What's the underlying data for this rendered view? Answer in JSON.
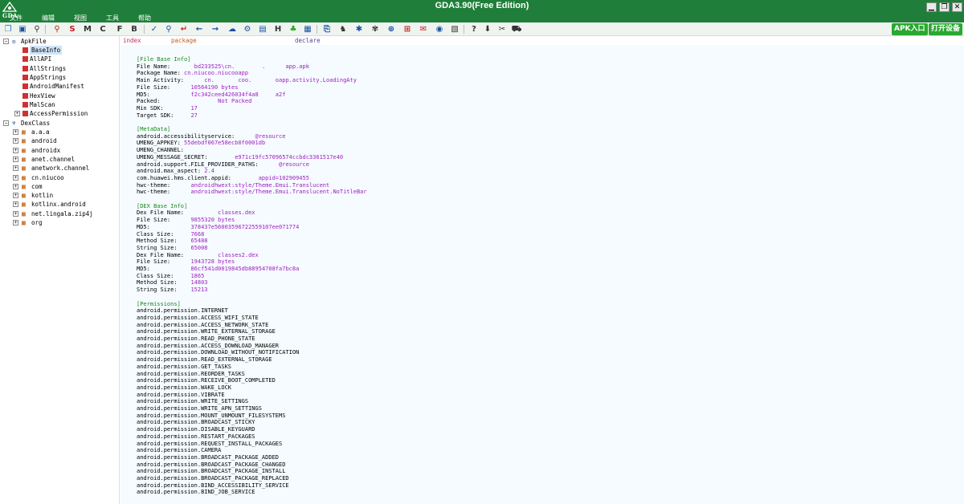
{
  "window": {
    "title": "GDA3.90(Free Edition)",
    "logo_text": "GDA",
    "menu": [
      "文件",
      "编辑",
      "视图",
      "工具",
      "帮助"
    ],
    "controls": [
      "minimize",
      "restore",
      "close"
    ]
  },
  "toolbar": {
    "letter_buttons": [
      "S",
      "M",
      "C",
      "F",
      "B"
    ],
    "apk_entry_label": "APK入口",
    "open_device_label": "打开设备"
  },
  "tree": {
    "apk_root": "ApkFile",
    "apk_children": [
      "BaseInfo",
      "AllAPI",
      "AllStrings",
      "AppStrings",
      "AndroidManifest",
      "HexView",
      "MalScan",
      "AccessPermission"
    ],
    "dex_root": "DexClass",
    "dex_children": [
      "a.a.a",
      "android",
      "androidx",
      "anet.channel",
      "anetwork.channel",
      "cn.niucoo",
      "com",
      "kotlin",
      "kotlinx.android",
      "net.lingala.zip4j",
      "org"
    ]
  },
  "columns": [
    "index",
    "package",
    "declare"
  ],
  "lines": [
    {
      "t": "sec",
      "text": "[File Base Info]"
    },
    {
      "t": "kv",
      "k": "File Name:       ",
      "v": "bd233525\\cn.        .      app.apk"
    },
    {
      "t": "kv",
      "k": "Package Name: ",
      "v": "cn.niucoo.niucooapp"
    },
    {
      "t": "kv",
      "k": "Main Activity:      ",
      "v": "cn.       coo.       oapp.activity.LoadingAty"
    },
    {
      "t": "kv",
      "k": "File Size:      ",
      "v": "10564190 bytes"
    },
    {
      "t": "kv",
      "k": "MD5:            ",
      "v": "f2c342ceed426034f4a8     a2f"
    },
    {
      "t": "kv",
      "k": "Packed:                 ",
      "v": "Not Packed"
    },
    {
      "t": "kv",
      "k": "Min SDK:        ",
      "v": "17"
    },
    {
      "t": "kv",
      "k": "Target SDK:     ",
      "v": "27"
    },
    {
      "t": "gap"
    },
    {
      "t": "sec",
      "text": "[MetaData]"
    },
    {
      "t": "kv",
      "k": "android.accessibilityservice:      ",
      "v": "@resource"
    },
    {
      "t": "kv",
      "k": "UMENG_APPKEY: ",
      "v": "55debdf067e58ecb0f0001db"
    },
    {
      "t": "kv",
      "k": "UMENG_CHANNEL:  ",
      "v": "     "
    },
    {
      "t": "kv",
      "k": "UMENG_MESSAGE_SECRET:        ",
      "v": "e971c19fc57096574ccbdc3361517e40"
    },
    {
      "t": "kv",
      "k": "android.support.FILE_PROVIDER_PATHS:      ",
      "v": "@resource"
    },
    {
      "t": "kv",
      "k": "android.max_aspect: ",
      "v": "2.4"
    },
    {
      "t": "kv",
      "k": "com.huawei.hms.client.appid:        ",
      "v": "appid=102909455"
    },
    {
      "t": "kv",
      "k": "hwc-theme:      ",
      "v": "androidhwext:style/Theme.Emui.Translucent"
    },
    {
      "t": "kv",
      "k": "hwc-theme:      ",
      "v": "androidhwext:style/Theme.Emui.Translucent.NoTitleBar"
    },
    {
      "t": "gap"
    },
    {
      "t": "sec",
      "text": "[DEX Base Info]"
    },
    {
      "t": "kv",
      "k": "Dex File Name:          ",
      "v": "classes.dex"
    },
    {
      "t": "kv",
      "k": "File Size:      ",
      "v": "9855320 bytes"
    },
    {
      "t": "kv",
      "k": "MD5:            ",
      "v": "378437e56003596722559107ee071774"
    },
    {
      "t": "kv",
      "k": "Class Size:     ",
      "v": "7668"
    },
    {
      "t": "kv",
      "k": "Method Size:    ",
      "v": "65488"
    },
    {
      "t": "kv",
      "k": "String Size:    ",
      "v": "65008"
    },
    {
      "t": "kv",
      "k": "Dex File Name:          ",
      "v": "classes2.dex"
    },
    {
      "t": "kv",
      "k": "File Size:      ",
      "v": "1943728 bytes"
    },
    {
      "t": "kv",
      "k": "MD5:            ",
      "v": "86cf541d0019845db88954708fa7bc8a"
    },
    {
      "t": "kv",
      "k": "Class Size:     ",
      "v": "1865"
    },
    {
      "t": "kv",
      "k": "Method Size:    ",
      "v": "14803"
    },
    {
      "t": "kv",
      "k": "String Size:    ",
      "v": "15213"
    },
    {
      "t": "gap"
    },
    {
      "t": "sec",
      "text": "[Permissions]"
    },
    {
      "t": "p",
      "text": "android.permission.INTERNET"
    },
    {
      "t": "p",
      "text": "android.permission.ACCESS_WIFI_STATE"
    },
    {
      "t": "p",
      "text": "android.permission.ACCESS_NETWORK_STATE"
    },
    {
      "t": "p",
      "text": "android.permission.WRITE_EXTERNAL_STORAGE"
    },
    {
      "t": "p",
      "text": "android.permission.READ_PHONE_STATE"
    },
    {
      "t": "p",
      "text": "android.permission.ACCESS_DOWNLOAD_MANAGER"
    },
    {
      "t": "p",
      "text": "android.permission.DOWNLOAD_WITHOUT_NOTIFICATION"
    },
    {
      "t": "p",
      "text": "android.permission.READ_EXTERNAL_STORAGE"
    },
    {
      "t": "p",
      "text": "android.permission.GET_TASKS"
    },
    {
      "t": "p",
      "text": "android.permission.REORDER_TASKS"
    },
    {
      "t": "p",
      "text": "android.permission.RECEIVE_BOOT_COMPLETED"
    },
    {
      "t": "p",
      "text": "android.permission.WAKE_LOCK"
    },
    {
      "t": "p",
      "text": "android.permission.VIBRATE"
    },
    {
      "t": "p",
      "text": "android.permission.WRITE_SETTINGS"
    },
    {
      "t": "p",
      "text": "android.permission.WRITE_APN_SETTINGS"
    },
    {
      "t": "p",
      "text": "android.permission.MOUNT_UNMOUNT_FILESYSTEMS"
    },
    {
      "t": "p",
      "text": "android.permission.BROADCAST_STICKY"
    },
    {
      "t": "p",
      "text": "android.permission.DISABLE_KEYGUARD"
    },
    {
      "t": "p",
      "text": "android.permission.RESTART_PACKAGES"
    },
    {
      "t": "p",
      "text": "android.permission.REQUEST_INSTALL_PACKAGES"
    },
    {
      "t": "p",
      "text": "android.permission.CAMERA"
    },
    {
      "t": "p",
      "text": "android.permission.BROADCAST_PACKAGE_ADDED"
    },
    {
      "t": "p",
      "text": "android.permission.BROADCAST_PACKAGE_CHANGED"
    },
    {
      "t": "p",
      "text": "android.permission.BROADCAST_PACKAGE_INSTALL"
    },
    {
      "t": "p",
      "text": "android.permission.BROADCAST_PACKAGE_REPLACED"
    },
    {
      "t": "p",
      "text": "android.permission.BIND_ACCESSIBILITY_SERVICE"
    },
    {
      "t": "p",
      "text": "android.permission.BIND_JOB_SERVICE"
    }
  ]
}
